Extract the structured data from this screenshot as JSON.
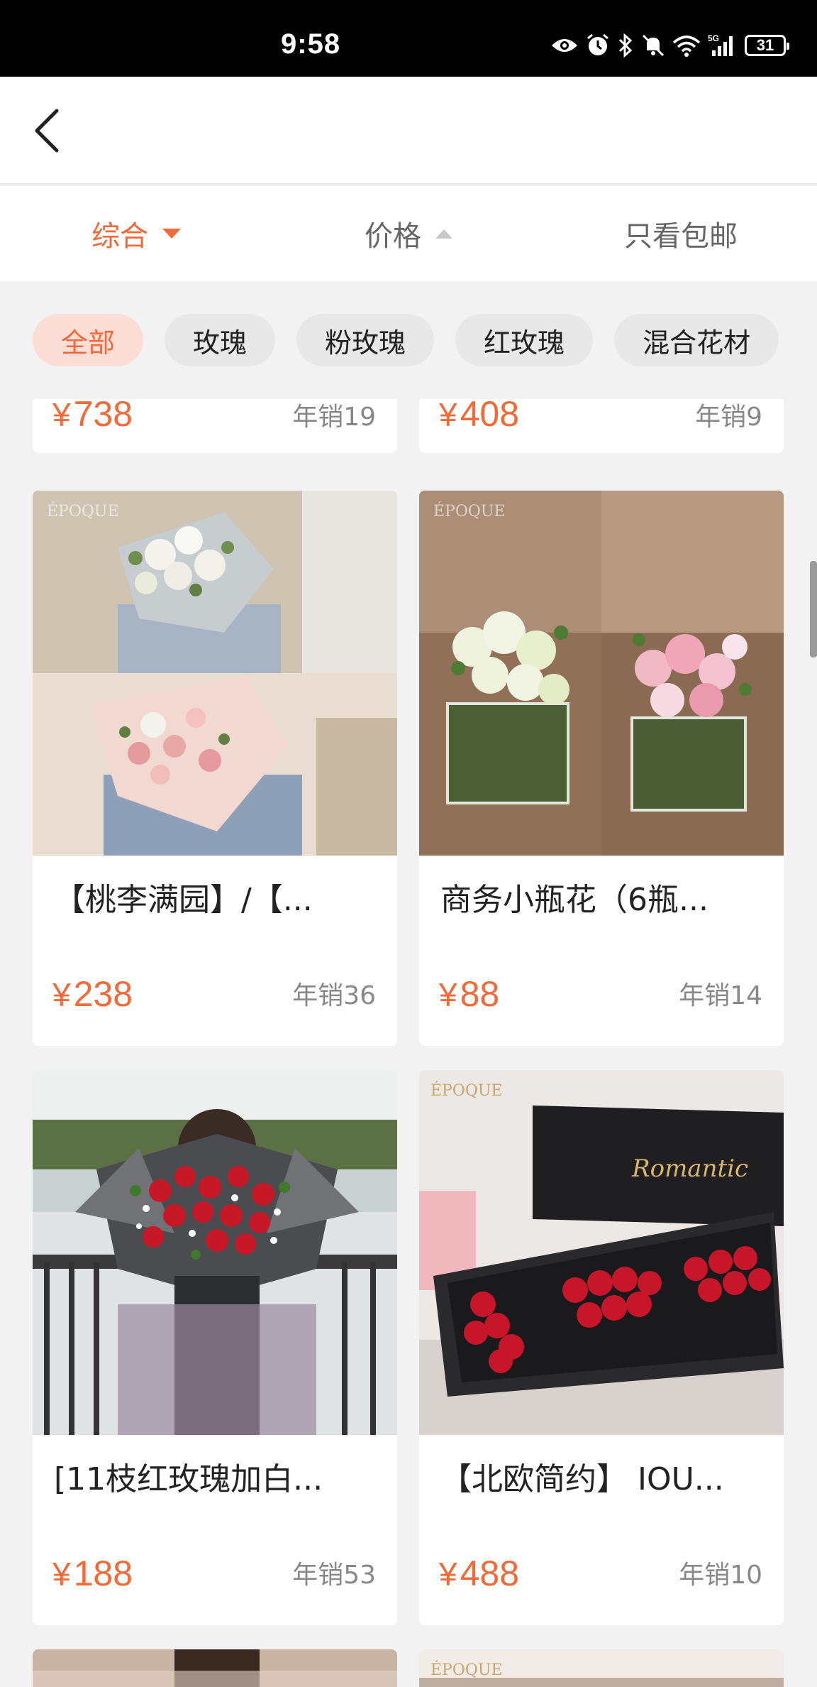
{
  "status_bar": {
    "time": "9:58",
    "battery": "31",
    "icons": [
      "eye-icon",
      "alarm-icon",
      "bluetooth-icon",
      "mute-icon",
      "wifi-icon",
      "signal-5g-icon",
      "battery-icon"
    ]
  },
  "nav": {
    "back_icon": "chevron-left-icon"
  },
  "sort_bar": {
    "items": [
      {
        "label": "综合",
        "active": true
      },
      {
        "label": "价格",
        "active": false
      },
      {
        "label": "只看包邮",
        "active": false
      }
    ]
  },
  "categories": [
    {
      "label": "全部",
      "active": true
    },
    {
      "label": "玫瑰"
    },
    {
      "label": "粉玫瑰"
    },
    {
      "label": "红玫瑰"
    },
    {
      "label": "混合花材"
    }
  ],
  "products": [
    {
      "title": "",
      "price": "738",
      "sales": "年销19"
    },
    {
      "title": "",
      "price": "408",
      "sales": "年销9"
    },
    {
      "title": "【桃李满园】/【...",
      "price": "238",
      "sales": "年销36"
    },
    {
      "title": "商务小瓶花（6瓶...",
      "price": "88",
      "sales": "年销14"
    },
    {
      "title": "[11枝红玫瑰加白...",
      "price": "188",
      "sales": "年销53"
    },
    {
      "title": "【北欧简约】 IOU...",
      "price": "488",
      "sales": "年销10"
    }
  ],
  "currency": "¥",
  "images": {
    "watermark": "ÉPOQUE",
    "box_text": "Romantic"
  },
  "colors": {
    "accent": "#f06a3a",
    "chip_active_bg": "#fcded6",
    "background": "#f2f2f2"
  }
}
